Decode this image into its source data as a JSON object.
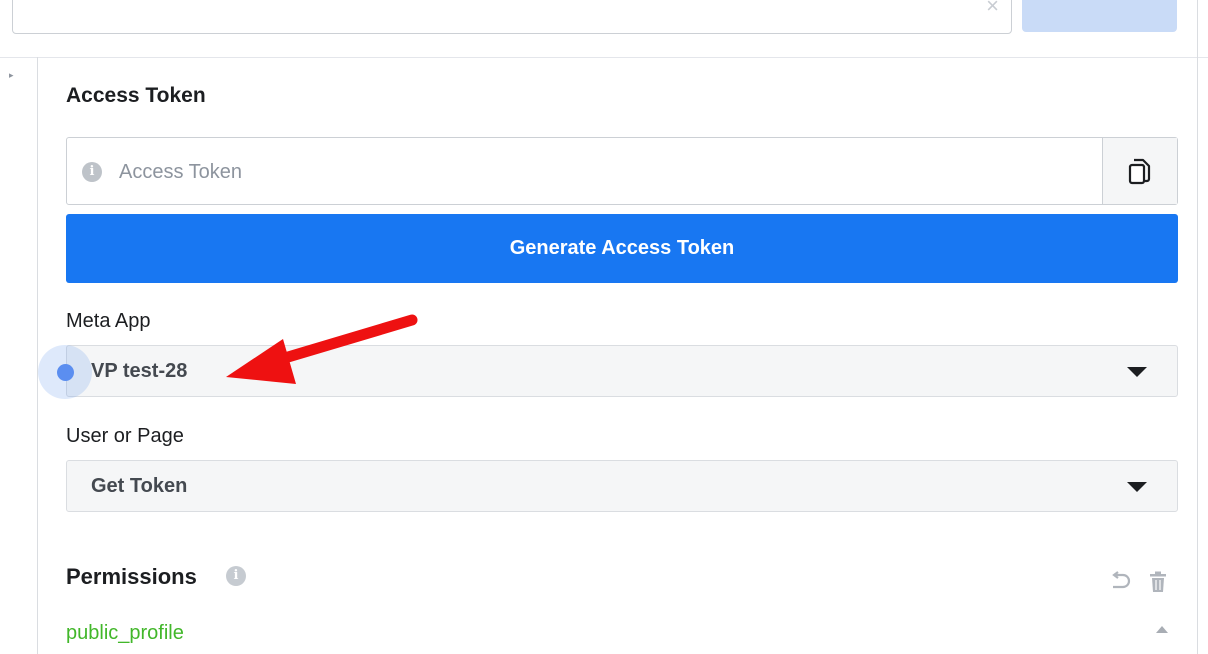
{
  "top": {
    "clear_glyph": "×"
  },
  "access_token": {
    "title": "Access Token",
    "input_placeholder": "Access Token",
    "input_value": "",
    "info_glyph": "i",
    "generate_label": "Generate Access Token"
  },
  "meta_app": {
    "label": "Meta App",
    "selected": "VP test-28"
  },
  "user_or_page": {
    "label": "User or Page",
    "selected": "Get Token"
  },
  "permissions": {
    "title": "Permissions",
    "info_glyph": "i",
    "items": [
      "public_profile"
    ]
  },
  "icons": {
    "copy": "copy-icon",
    "info": "info-icon",
    "dropdown": "caret-down-icon",
    "undo": "undo-icon",
    "trash": "trash-icon",
    "arrow": "red-arrow-annotation"
  },
  "colors": {
    "primary": "#1877f2",
    "permission_granted": "#42b72a",
    "annotation_arrow": "#ee1111",
    "click_marker": "#5b8ef0"
  }
}
